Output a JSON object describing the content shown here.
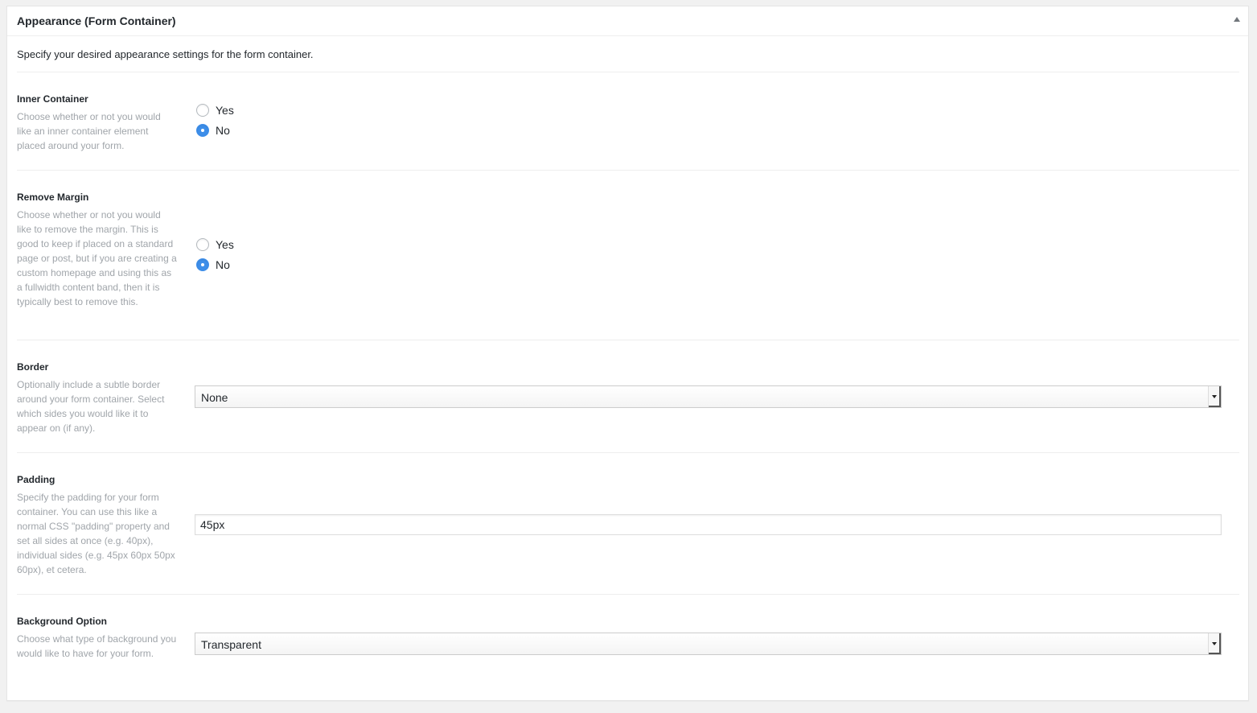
{
  "panel": {
    "title": "Appearance (Form Container)",
    "intro": "Specify your desired appearance settings for the form container."
  },
  "fields": {
    "inner_container": {
      "label": "Inner Container",
      "description": "Choose whether or not you would like an inner container element placed around your form.",
      "options": [
        "Yes",
        "No"
      ],
      "selected": "No"
    },
    "remove_margin": {
      "label": "Remove Margin",
      "description": "Choose whether or not you would like to remove the margin. This is good to keep if placed on a standard page or post, but if you are creating a custom homepage and using this as a fullwidth content band, then it is typically best to remove this.",
      "options": [
        "Yes",
        "No"
      ],
      "selected": "No"
    },
    "border": {
      "label": "Border",
      "description": "Optionally include a subtle border around your form container. Select which sides you would like it to appear on (if any).",
      "value": "None"
    },
    "padding": {
      "label": "Padding",
      "description": "Specify the padding for your form container. You can use this like a normal CSS \"padding\" property and set all sides at once (e.g. 40px), individual sides (e.g. 45px 60px 50px 60px), et cetera.",
      "value": "45px"
    },
    "background_option": {
      "label": "Background Option",
      "description": "Choose what type of background you would like to have for your form.",
      "value": "Transparent"
    }
  },
  "colors": {
    "radio_checked": "#3d8ee9",
    "description_text": "#a0a5aa"
  }
}
